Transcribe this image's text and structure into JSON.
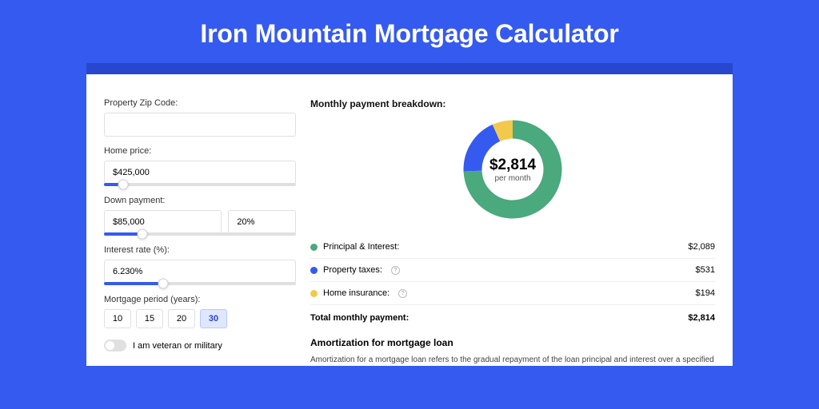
{
  "page_title": "Iron Mountain Mortgage Calculator",
  "form": {
    "zip_label": "Property Zip Code:",
    "zip_value": "",
    "price_label": "Home price:",
    "price_value": "$425,000",
    "price_slider_pct": 10,
    "down_label": "Down payment:",
    "down_amount": "$85,000",
    "down_pct": "20%",
    "down_slider_pct": 20,
    "rate_label": "Interest rate (%):",
    "rate_value": "6.230%",
    "rate_slider_pct": 31,
    "period_label": "Mortgage period (years):",
    "periods": [
      "10",
      "15",
      "20",
      "30"
    ],
    "period_active": "30",
    "veteran_label": "I am veteran or military",
    "veteran_on": false
  },
  "breakdown": {
    "title": "Monthly payment breakdown:",
    "center_value": "$2,814",
    "center_sub": "per month",
    "items": [
      {
        "key": "pi",
        "label": "Principal & Interest:",
        "value": "$2,089",
        "color": "#4aa97d",
        "has_info": false
      },
      {
        "key": "tax",
        "label": "Property taxes:",
        "value": "$531",
        "color": "#355af0",
        "has_info": true
      },
      {
        "key": "ins",
        "label": "Home insurance:",
        "value": "$194",
        "color": "#f2c94c",
        "has_info": true
      }
    ],
    "total_label": "Total monthly payment:",
    "total_value": "$2,814",
    "donut_segments": [
      {
        "color": "#4aa97d",
        "pct": 74.2
      },
      {
        "color": "#355af0",
        "pct": 18.9
      },
      {
        "color": "#f2c94c",
        "pct": 6.9
      }
    ]
  },
  "amort": {
    "title": "Amortization for mortgage loan",
    "text": "Amortization for a mortgage loan refers to the gradual repayment of the loan principal and interest over a specified"
  },
  "chart_data": {
    "type": "pie",
    "title": "Monthly payment breakdown:",
    "categories": [
      "Principal & Interest",
      "Property taxes",
      "Home insurance"
    ],
    "values": [
      2089,
      531,
      194
    ],
    "total": 2814,
    "unit": "USD"
  }
}
